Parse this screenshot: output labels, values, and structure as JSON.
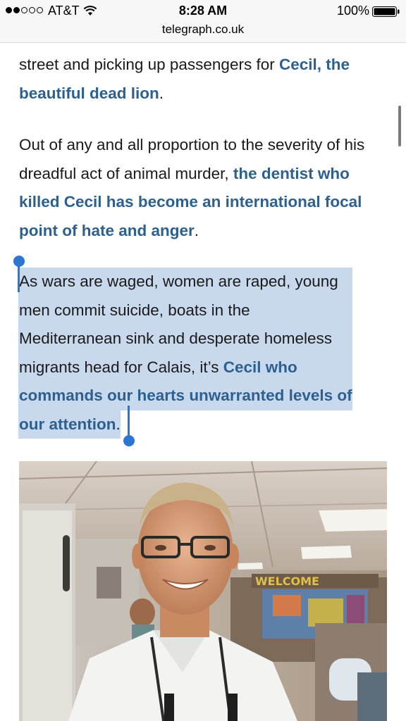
{
  "status_bar": {
    "carrier": "AT&T",
    "time": "8:28 AM",
    "battery": "100%",
    "signal_bars_filled": 2,
    "signal_bars_total": 5,
    "icons": [
      "wifi-icon",
      "battery-icon"
    ]
  },
  "browser": {
    "url": "telegraph.co.uk"
  },
  "article": {
    "p1": {
      "text": "street and picking up passengers for ",
      "link": "Cecil, the beautiful dead lion",
      "end": "."
    },
    "p2": {
      "text": "Out of any and all proportion to the severity of his dreadful act of animal murder, ",
      "link": "the dentist who killed Cecil has become an international focal point of hate and anger",
      "end": "."
    },
    "p3": {
      "lines": [
        "As wars are waged, women are raped, young",
        "men commit suicide, boats in the",
        "Mediterranean sink and desperate homeless"
      ],
      "line4_text": "migrants head for Calais, it’s ",
      "line4_link": "Cecil who",
      "line5_link": "commands our hearts unwarranted levels of",
      "line6_link": "our attention",
      "end": "."
    }
  },
  "photo": {
    "sign_text": "WELCOME"
  },
  "colors": {
    "link": "#2d5f8f",
    "selection": "#c8d9ee",
    "handle": "#2b75d4"
  }
}
